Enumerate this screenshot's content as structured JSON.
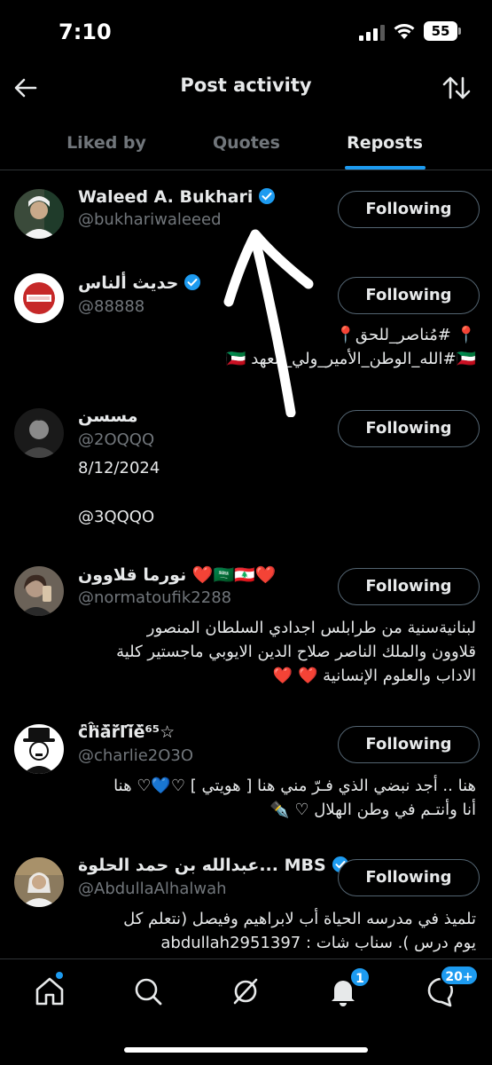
{
  "status_bar": {
    "time": "7:10",
    "battery": "55"
  },
  "header": {
    "title": "Post activity"
  },
  "tabs": [
    {
      "label": "Liked by",
      "active": false
    },
    {
      "label": "Quotes",
      "active": false
    },
    {
      "label": "Reposts",
      "active": true
    }
  ],
  "users": [
    {
      "name": "Waleed A. Bukhari",
      "handle": "@bukhariwaleeed",
      "verified": true,
      "button": "Following",
      "bio": []
    },
    {
      "name": "حديث ألناس",
      "handle": "@88888",
      "verified": true,
      "button": "Following",
      "bio": [
        "📍 #مُناصر_للحق📍",
        "🇰🇼#الله_الوطن_الأمير_ولي_العهد 🇰🇼"
      ]
    },
    {
      "name": "مسسن",
      "handle": "@2OQQQ",
      "verified": false,
      "button": "Following",
      "bio": [
        "8/12/2024",
        "@3QQQO"
      ]
    },
    {
      "name": "نورما قلاوون ❤️🇸🇦🇱🇧❤️",
      "handle": "@normatoufik2288",
      "verified": false,
      "button": "Following",
      "bio": [
        "لبنانيةسنية من طرابلس اجدادي السلطان المنصور",
        "قلاوون والملك الناصر صلاح الدين الايوبي ماجستير كلية",
        "الاداب والعلوم الإنسانية ❤️ ❤️"
      ]
    },
    {
      "name": "ĉ̈ĥ̈ǎ̈ř̈ľ̈ǐ̈ě̈⁶⁵☆",
      "handle": "@charlie2O3O",
      "verified": false,
      "button": "Following",
      "bio": [
        "هنا .. أجد نبضي الذي فـرّ مني هنا [ هويتي ] ♡💙♡ هنا",
        "أنا وأنتـم في وطن الهلال ♡ ✒️"
      ]
    },
    {
      "name": "عبدالله بن حمد الحلوة... MBS",
      "handle": "@AbdullaAlhalwah",
      "verified": true,
      "button": "Following",
      "bio": [
        "تلميذ في مدرسه الحياة أب لابراهيم وفيصل (نتعلم كل",
        "يوم درس ). سناب شات : abdullah2951397"
      ]
    }
  ],
  "bottom_nav": {
    "items": [
      "home-icon",
      "search-icon",
      "grok-icon",
      "notifications-icon",
      "messages-icon"
    ],
    "notifications_badge": "1",
    "messages_badge": "20+"
  },
  "colors": {
    "accent": "#1d9bf0",
    "muted": "#71767b",
    "text": "#e7e9ea"
  }
}
